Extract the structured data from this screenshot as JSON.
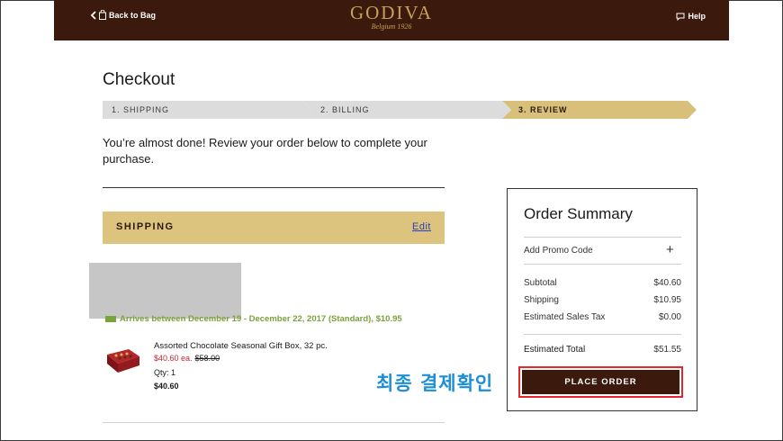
{
  "header": {
    "back_label": "Back to Bag",
    "brand_name": "GODIVA",
    "brand_tagline": "Belgium 1926",
    "help_label": "Help",
    "brand_color": "#3b1a0d",
    "gold_color": "#c7a15a"
  },
  "page": {
    "title": "Checkout",
    "intro": "You’re almost done! Review your order below to complete your purchase."
  },
  "steps": [
    {
      "label": "1. SHIPPING",
      "state": "complete"
    },
    {
      "label": "2. BILLING",
      "state": "complete"
    },
    {
      "label": "3. REVIEW",
      "state": "active"
    }
  ],
  "shipping": {
    "heading": "SHIPPING",
    "edit_label": "Edit",
    "arrival_text": "Arrives between December 19 - December 22, 2017 (Standard), $10.95",
    "item": {
      "name": "Assorted Chocolate Seasonal Gift Box, 32 pc.",
      "price_each": "$40.60 ea.",
      "original_price": "$58.00",
      "qty": "Qty: 1",
      "total": "$40.60"
    }
  },
  "summary": {
    "title": "Order Summary",
    "promo_label": "Add Promo Code",
    "promo_icon": "plus-icon",
    "subtotal_label": "Subtotal",
    "subtotal_value": "$40.60",
    "shipping_label": "Shipping",
    "shipping_value": "$10.95",
    "tax_label": "Estimated Sales Tax",
    "tax_value": "$0.00",
    "total_label": "Estimated Total",
    "total_value": "$51.55",
    "place_order_label": "PLACE ORDER"
  },
  "annotation": {
    "text": "최종 결제확인",
    "color": "#1d8fd6",
    "highlight_color": "#e8252a"
  }
}
